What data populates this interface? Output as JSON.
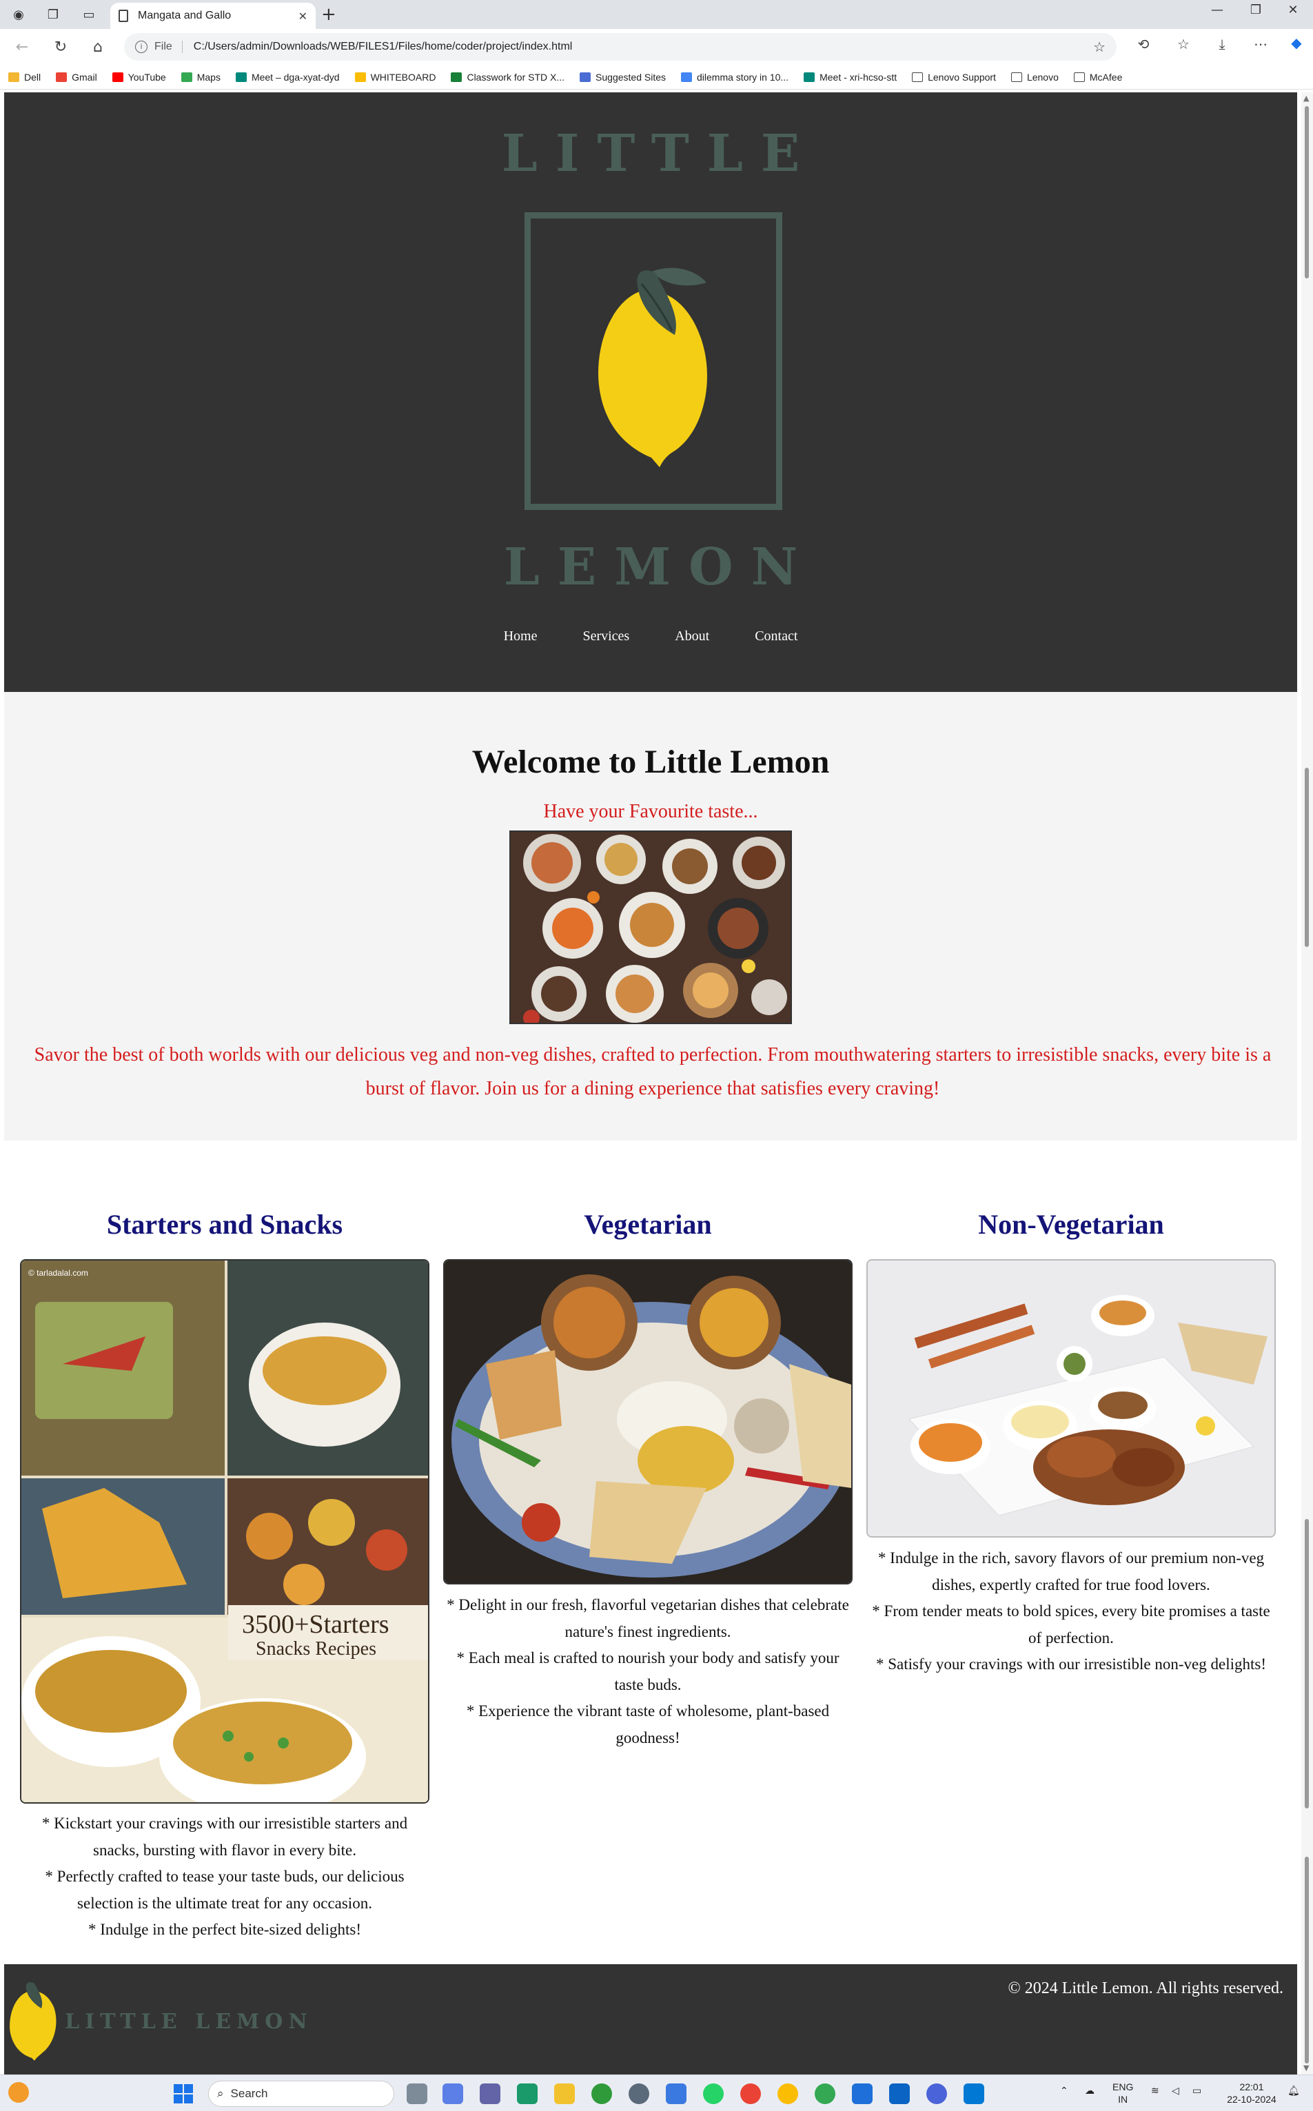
{
  "browser": {
    "tab_title": "Mangata and Gallo",
    "url_scheme": "File",
    "url": "C:/Users/admin/Downloads/WEB/FILES1/Files/home/coder/project/index.html",
    "bookmarks": [
      "Dell",
      "Gmail",
      "YouTube",
      "Maps",
      "Meet – dga-xyat-dyd",
      "WHITEBOARD",
      "Classwork for STD X...",
      "Suggested Sites",
      "dilemma story in 10...",
      "Meet - xri-hcso-stt",
      "Lenovo Support",
      "Lenovo",
      "McAfee"
    ]
  },
  "header": {
    "logo_top": "LITTLE",
    "logo_bottom": "LEMON",
    "nav": [
      "Home",
      "Services",
      "About",
      "Contact"
    ]
  },
  "welcome": {
    "title": "Welcome to Little Lemon",
    "tagline": "Have your Favourite taste...",
    "description": "Savor the best of both worlds with our delicious veg and non-veg dishes, crafted to perfection. From mouthwatering starters to irresistible snacks, every bite is a burst of flavor. Join us for a dining experience that satisfies every craving!"
  },
  "cards": [
    {
      "title": "Starters and Snacks",
      "image_watermark": "© tarladalal.com",
      "image_caption_1": "3500+Starters",
      "image_caption_2": "Snacks Recipes",
      "lines": [
        "* Kickstart your cravings with our irresistible starters and snacks, bursting with flavor in every bite.",
        "* Perfectly crafted to tease your taste buds, our delicious selection is the ultimate treat for any occasion.",
        "* Indulge in the perfect bite-sized delights!"
      ]
    },
    {
      "title": "Vegetarian",
      "lines": [
        "* Delight in our fresh, flavorful vegetarian dishes that celebrate nature's finest ingredients.",
        "* Each meal is crafted to nourish your body and satisfy your taste buds.",
        "* Experience the vibrant taste of wholesome, plant-based goodness!"
      ]
    },
    {
      "title": "Non-Vegetarian",
      "lines": [
        "* Indulge in the rich, savory flavors of our premium non-veg dishes, expertly crafted for true food lovers.",
        "* From tender meats to bold spices, every bite promises a taste of perfection.",
        "* Satisfy your cravings with our irresistible non-veg delights!"
      ]
    }
  ],
  "footer": {
    "logo": "LITTLE LEMON",
    "copyright": "© 2024 Little Lemon. All rights reserved."
  },
  "taskbar": {
    "search": "Search",
    "lang_1": "ENG",
    "lang_2": "IN",
    "time": "22:01",
    "date": "22-10-2024"
  },
  "colors": {
    "header_bg": "#333333",
    "logo_green": "#495e57",
    "lemon_yellow": "#f4ce14",
    "accent_red": "#d41d1d",
    "card_title": "#141478"
  }
}
